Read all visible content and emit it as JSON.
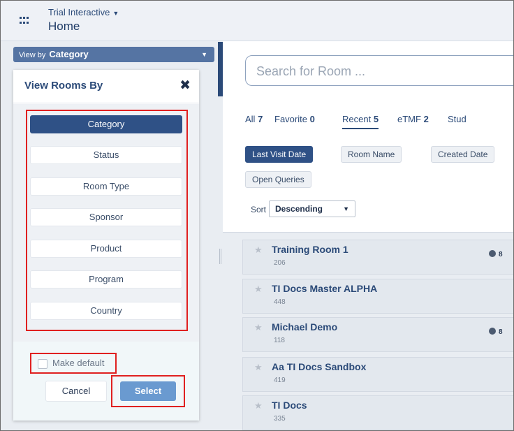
{
  "header": {
    "app_name": "Trial Interactive",
    "page_title": "Home",
    "menu_icon": "grid-icon"
  },
  "left_panel": {
    "viewby_prefix": "View by",
    "viewby_value": "Category",
    "dialog": {
      "title": "View Rooms By",
      "close_icon": "✖",
      "options": [
        "Category",
        "Status",
        "Room Type",
        "Sponsor",
        "Product",
        "Program",
        "Country"
      ],
      "selected": "Category",
      "make_default_label": "Make default",
      "cancel_label": "Cancel",
      "select_label": "Select"
    }
  },
  "main": {
    "search_placeholder": "Search for Room ...",
    "tabs": [
      {
        "label": "All",
        "count": "7"
      },
      {
        "label": "Favorite",
        "count": "0"
      },
      {
        "label": "Recent",
        "count": "5"
      },
      {
        "label": "eTMF",
        "count": "2"
      },
      {
        "label": "Stud",
        "count": ""
      }
    ],
    "active_tab": "Recent",
    "sort_chips": [
      "Last Visit Date",
      "Room Name",
      "Created Date",
      "Open Queries"
    ],
    "active_sort_chip": "Last Visit Date",
    "sort_label": "Sort",
    "sort_value": "Descending",
    "rooms": [
      {
        "name": "Training Room 1",
        "count": "206",
        "badge": "8"
      },
      {
        "name": "TI Docs Master ALPHA",
        "count": "448",
        "badge": ""
      },
      {
        "name": "Michael Demo",
        "count": "118",
        "badge": "8"
      },
      {
        "name": "Aa TI Docs Sandbox",
        "count": "419",
        "badge": ""
      },
      {
        "name": "TI Docs",
        "count": "335",
        "badge": ""
      }
    ]
  },
  "colors": {
    "accent": "#2f5186",
    "highlight_border": "#e02020",
    "select_button": "#6a9ad0"
  }
}
